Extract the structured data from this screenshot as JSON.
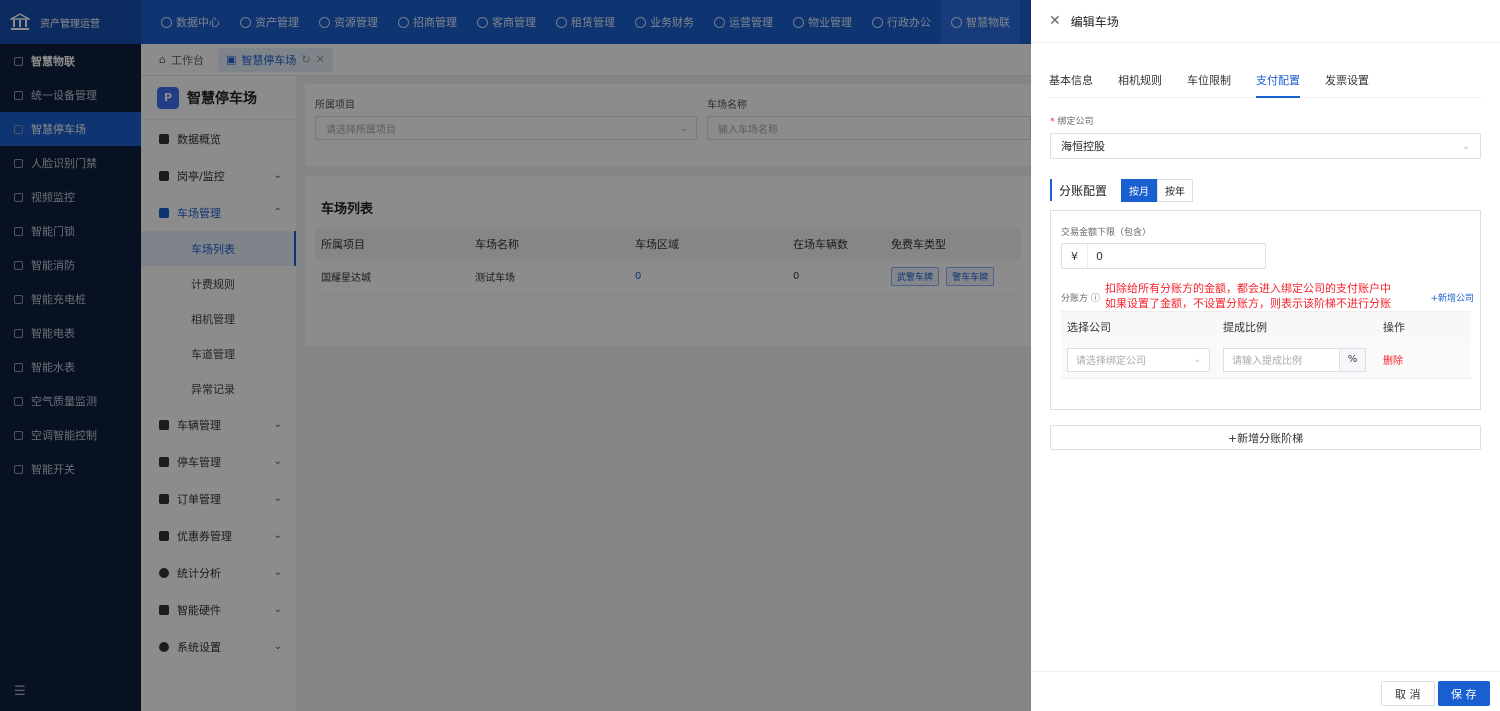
{
  "topbar": {
    "brand": "资产管理运营",
    "nav": [
      "数据中心",
      "资产管理",
      "资源管理",
      "招商管理",
      "客商管理",
      "租赁管理",
      "业务财务",
      "运营管理",
      "物业管理",
      "行政办公",
      "智慧物联"
    ]
  },
  "sidebar": {
    "items": [
      "智慧物联",
      "统一设备管理",
      "智慧停车场",
      "人脸识别门禁",
      "视频监控",
      "智能门锁",
      "智能消防",
      "智能充电桩",
      "智能电表",
      "智能水表",
      "空气质量监测",
      "空调智能控制",
      "智能开关"
    ],
    "collapse_icon": "☰"
  },
  "tabs": {
    "workbench": "工作台",
    "parking": "智慧停车场"
  },
  "subsidebar": {
    "title": "智慧停车场",
    "logo": "P",
    "menus": [
      "数据概览",
      "岗亭/监控",
      "车场管理"
    ],
    "children": [
      "车场列表",
      "计费规则",
      "相机管理",
      "车道管理",
      "异常记录"
    ],
    "menus_after": [
      "车辆管理",
      "停车管理",
      "订单管理",
      "优惠券管理",
      "统计分析",
      "智能硬件",
      "系统设置"
    ]
  },
  "filter": {
    "project_label": "所属项目",
    "project_placeholder": "请选择所属项目",
    "name_label": "车场名称",
    "name_placeholder": "输入车场名称"
  },
  "list": {
    "title": "车场列表",
    "columns": [
      "所属项目",
      "车场名称",
      "车场区域",
      "在场车辆数",
      "免费车类型"
    ],
    "rows": [
      {
        "project": "国耀星达城",
        "name": "测试车场",
        "area": "0",
        "count": "0",
        "tags": [
          "武警车牌",
          "警车车牌"
        ]
      }
    ]
  },
  "drawer": {
    "title": "编辑车场",
    "tabs": [
      "基本信息",
      "相机规则",
      "车位限制",
      "支付配置",
      "发票设置"
    ],
    "company_label": "绑定公司",
    "company_value": "海恒控股",
    "split_title": "分账配置",
    "seg_month": "按月",
    "seg_year": "按年",
    "amount_label": "交易金额下限（包含）",
    "currency": "¥",
    "amount_value": "0",
    "party_label": "分账方",
    "hint_line1": "扣除给所有分账方的金额，都会进入绑定公司的支付账户中",
    "hint_line2": "如果设置了金额，不设置分账方，则表示该阶梯不进行分账",
    "add_company": "+新增公司",
    "table_columns": [
      "选择公司",
      "提成比例",
      "操作"
    ],
    "company_placeholder": "请选择绑定公司",
    "ratio_placeholder": "请输入提成比例",
    "percent": "%",
    "delete": "删除",
    "add_step": "+新增分账阶梯",
    "cancel": "取 消",
    "save": "保 存"
  }
}
